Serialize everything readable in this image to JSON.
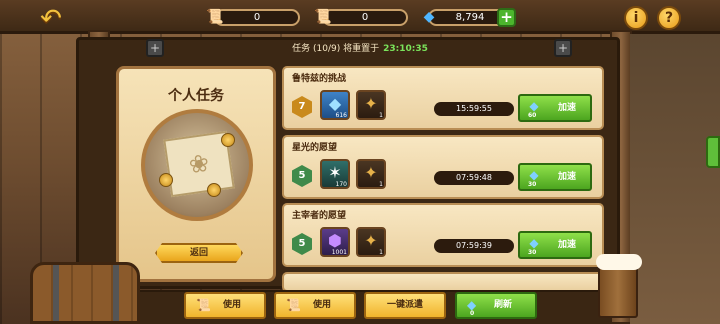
{
  "header": {
    "resources": [
      {
        "icon": "scroll-icon",
        "value": "0"
      },
      {
        "icon": "scroll-icon",
        "value": "0"
      },
      {
        "icon": "gem-icon",
        "value": "8,794"
      }
    ],
    "task_status": "任务 (10/9) 将重置于",
    "reset_timer": "23:10:35"
  },
  "left_panel": {
    "title": "个人任务",
    "back_label": "返回"
  },
  "tasks": [
    {
      "title": "鲁特兹的挑战",
      "level": "7",
      "rewards": [
        {
          "icon": "gem-icon",
          "count": "616"
        },
        {
          "icon": "medal-icon",
          "count": "1"
        }
      ],
      "time": "15:59:55",
      "speed_cost": "60",
      "speed_label": "加速"
    },
    {
      "title": "星光的愿望",
      "level": "5",
      "rewards": [
        {
          "icon": "wizard-icon",
          "count": "170"
        },
        {
          "icon": "medal-icon",
          "count": "1"
        }
      ],
      "time": "07:59:48",
      "speed_cost": "30",
      "speed_label": "加速"
    },
    {
      "title": "主宰者的愿望",
      "level": "5",
      "rewards": [
        {
          "icon": "purple-crystal-icon",
          "count": "1001"
        },
        {
          "icon": "medal-icon",
          "count": "1"
        }
      ],
      "time": "07:59:39",
      "speed_cost": "30",
      "speed_label": "加速"
    }
  ],
  "bottom": {
    "use1_label": "使用",
    "use2_label": "使用",
    "dispatch_label": "一键派遣",
    "refresh_label": "刷新",
    "refresh_cost": "0"
  }
}
